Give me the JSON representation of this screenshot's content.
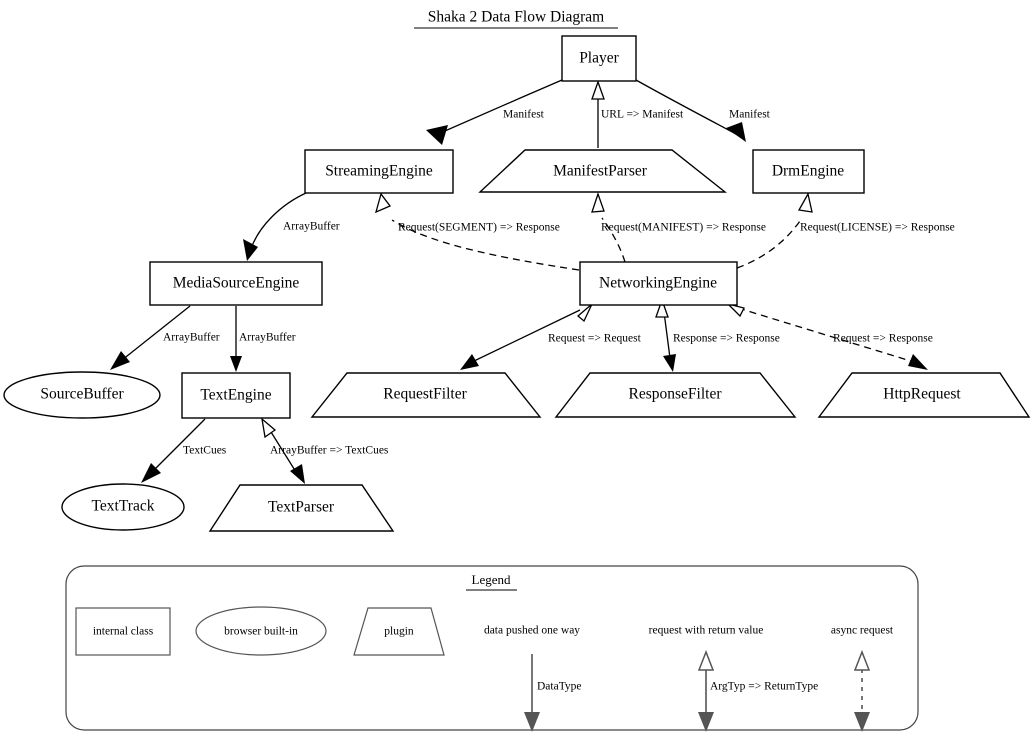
{
  "diagram": {
    "title": "Shaka 2 Data Flow Diagram",
    "nodes": [
      {
        "id": "player",
        "label": "Player",
        "shape": "box"
      },
      {
        "id": "streamingengine",
        "label": "StreamingEngine",
        "shape": "box"
      },
      {
        "id": "manifestparser",
        "label": "ManifestParser",
        "shape": "trapezoid"
      },
      {
        "id": "drmengine",
        "label": "DrmEngine",
        "shape": "box"
      },
      {
        "id": "mediasourceengine",
        "label": "MediaSourceEngine",
        "shape": "box"
      },
      {
        "id": "networkingengine",
        "label": "NetworkingEngine",
        "shape": "box"
      },
      {
        "id": "sourcebuffer",
        "label": "SourceBuffer",
        "shape": "ellipse"
      },
      {
        "id": "textengine",
        "label": "TextEngine",
        "shape": "box"
      },
      {
        "id": "requestfilter",
        "label": "RequestFilter",
        "shape": "trapezoid"
      },
      {
        "id": "responsefilter",
        "label": "ResponseFilter",
        "shape": "trapezoid"
      },
      {
        "id": "httprequest",
        "label": "HttpRequest",
        "shape": "trapezoid"
      },
      {
        "id": "texttrack",
        "label": "TextTrack",
        "shape": "ellipse"
      },
      {
        "id": "textparser",
        "label": "TextParser",
        "shape": "trapezoid"
      }
    ],
    "edges": [
      {
        "from": "player",
        "to": "streamingengine",
        "label": "Manifest",
        "style": "push"
      },
      {
        "from": "manifestparser",
        "to": "player",
        "label": "URL => Manifest",
        "style": "return"
      },
      {
        "from": "player",
        "to": "drmengine",
        "label": "Manifest",
        "style": "push"
      },
      {
        "from": "networkingengine",
        "to": "streamingengine",
        "label": "Request(SEGMENT) => Response",
        "style": "async"
      },
      {
        "from": "networkingengine",
        "to": "manifestparser",
        "label": "Request(MANIFEST) => Response",
        "style": "async"
      },
      {
        "from": "networkingengine",
        "to": "drmengine",
        "label": "Request(LICENSE) => Response",
        "style": "async"
      },
      {
        "from": "streamingengine",
        "to": "mediasourceengine",
        "label": "ArrayBuffer",
        "style": "push"
      },
      {
        "from": "mediasourceengine",
        "to": "sourcebuffer",
        "label": "ArrayBuffer",
        "style": "push"
      },
      {
        "from": "mediasourceengine",
        "to": "textengine",
        "label": "ArrayBuffer",
        "style": "push"
      },
      {
        "from": "networkingengine",
        "to": "requestfilter",
        "label": "Request => Request",
        "style": "return"
      },
      {
        "from": "networkingengine",
        "to": "responsefilter",
        "label": "Response => Response",
        "style": "return"
      },
      {
        "from": "networkingengine",
        "to": "httprequest",
        "label": "Request => Response",
        "style": "async"
      },
      {
        "from": "textengine",
        "to": "texttrack",
        "label": "TextCues",
        "style": "push"
      },
      {
        "from": "textengine",
        "to": "textparser",
        "label": "ArrayBuffer => TextCues",
        "style": "return"
      }
    ]
  },
  "legend": {
    "title": "Legend",
    "shapes": [
      {
        "label": "internal class",
        "shape": "box"
      },
      {
        "label": "browser built-in",
        "shape": "ellipse"
      },
      {
        "label": "plugin",
        "shape": "trapezoid"
      }
    ],
    "edges": [
      {
        "caption": "data pushed one way",
        "label": "DataType",
        "style": "push"
      },
      {
        "caption": "request with return value",
        "label": "ArgTyp => ReturnType",
        "style": "return"
      },
      {
        "caption": "async request",
        "label": "",
        "style": "async"
      }
    ]
  },
  "colors": {
    "background": "#ffffff",
    "stroke": "#000000",
    "legend_stroke": "#555555"
  }
}
